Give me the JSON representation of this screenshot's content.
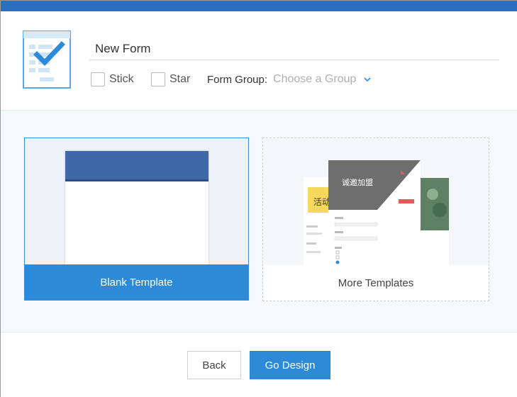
{
  "header": {
    "form_name": "New Form",
    "stick_label": "Stick",
    "star_label": "Star",
    "group_label": "Form Group:",
    "group_placeholder": "Choose a Group"
  },
  "templates": {
    "blank_label": "Blank Template",
    "more_label": "More Templates",
    "preview_banner_text": "诚邀加盟",
    "preview_left_text": "活动"
  },
  "footer": {
    "back_label": "Back",
    "go_label": "Go Design"
  },
  "colors": {
    "accent": "#2d8ad8",
    "topbar": "#2a6fc0"
  },
  "icons": {
    "form": "form-checklist-icon",
    "dropdown": "chevron-down-icon"
  }
}
